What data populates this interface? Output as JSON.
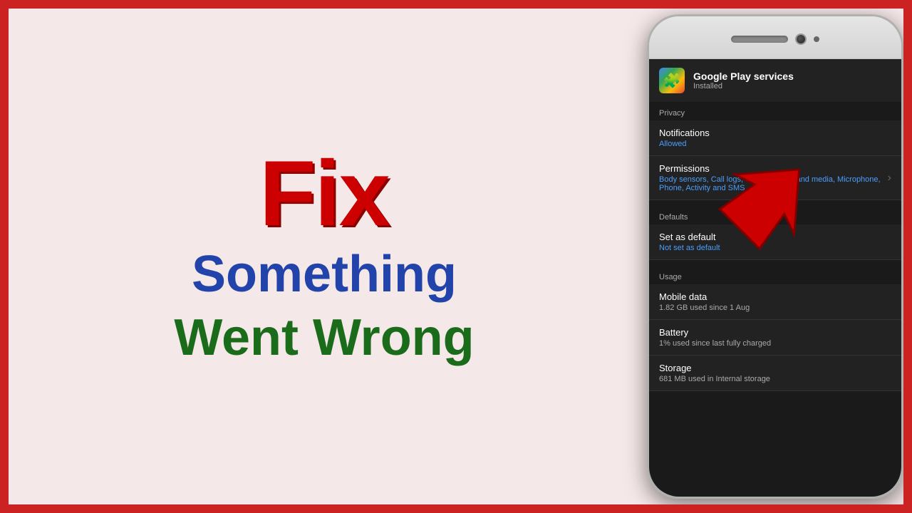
{
  "border": {
    "outer_color": "#cc2222",
    "inner_bg": "#f5e8e8"
  },
  "left": {
    "fix_label": "Fix",
    "something_label": "Something",
    "went_wrong_label": "Went Wrong"
  },
  "phone": {
    "app": {
      "name": "Google Play services",
      "status": "Installed",
      "icon": "🧩"
    },
    "sections": [
      {
        "label": "Privacy",
        "items": [
          {
            "title": "Notifications",
            "sub": "Allowed",
            "sub_color": "blue",
            "has_chevron": false
          },
          {
            "title": "Permissions",
            "sub": "Body sensors, Call logs, Camera, Files and media, Microphone, Phone, Activity and SMS",
            "sub_color": "blue",
            "has_chevron": true
          }
        ]
      },
      {
        "label": "Defaults",
        "items": [
          {
            "title": "Set as default",
            "sub": "Not set as default",
            "sub_color": "blue",
            "has_chevron": false
          }
        ]
      },
      {
        "label": "Usage",
        "items": [
          {
            "title": "Mobile data",
            "sub": "1.82 GB used since 1 Aug",
            "sub_color": "gray",
            "has_chevron": false
          },
          {
            "title": "Battery",
            "sub": "1% used since last fully charged",
            "sub_color": "gray",
            "has_chevron": false
          },
          {
            "title": "Storage",
            "sub": "681 MB used in Internal storage",
            "sub_color": "gray",
            "has_chevron": false
          }
        ]
      }
    ]
  }
}
